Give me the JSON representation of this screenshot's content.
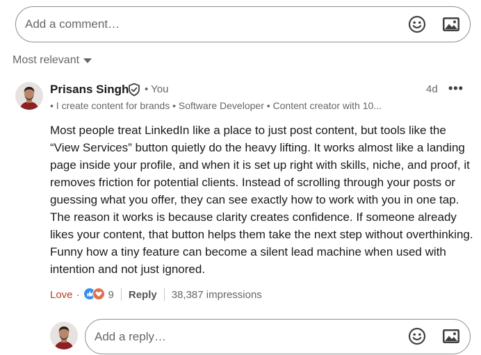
{
  "comment_box": {
    "placeholder": "Add a comment…",
    "emoji_icon": "smiley-icon",
    "image_icon": "image-icon"
  },
  "sort": {
    "label": "Most relevant",
    "icon": "caret-down-icon"
  },
  "comment": {
    "author": "Prisans Singh",
    "verified_icon": "shield-check-icon",
    "you_label": "• You",
    "time": "4d",
    "more_icon": "more-horizontal-icon",
    "more_glyph": "•••",
    "headline": "• I create content for brands • Software Developer • Content creator with 10...",
    "body": "Most people treat LinkedIn like a place to just post content, but tools like the “View Services” button quietly do the heavy lifting. It works almost like a landing page inside your profile, and when it is set up right with skills, niche, and proof, it removes friction for potential clients. Instead of scrolling through your posts or guessing what you offer, they can see exactly how to work with you in one tap. The reason it works is because clarity creates confidence. If someone already likes your content, that button helps them take the next step without overthinking. Funny how a tiny feature can become a silent lead machine when used with intention and not just ignored.",
    "reaction_label": "Love",
    "dot": "·",
    "reaction_count": "9",
    "reply_label": "Reply",
    "impressions": "38,387 impressions",
    "colors": {
      "love": "#b24020",
      "like_badge": "#378fe9",
      "heart_badge": "#df704d"
    }
  },
  "reply_box": {
    "placeholder": "Add a reply…",
    "emoji_icon": "smiley-icon",
    "image_icon": "image-icon"
  }
}
